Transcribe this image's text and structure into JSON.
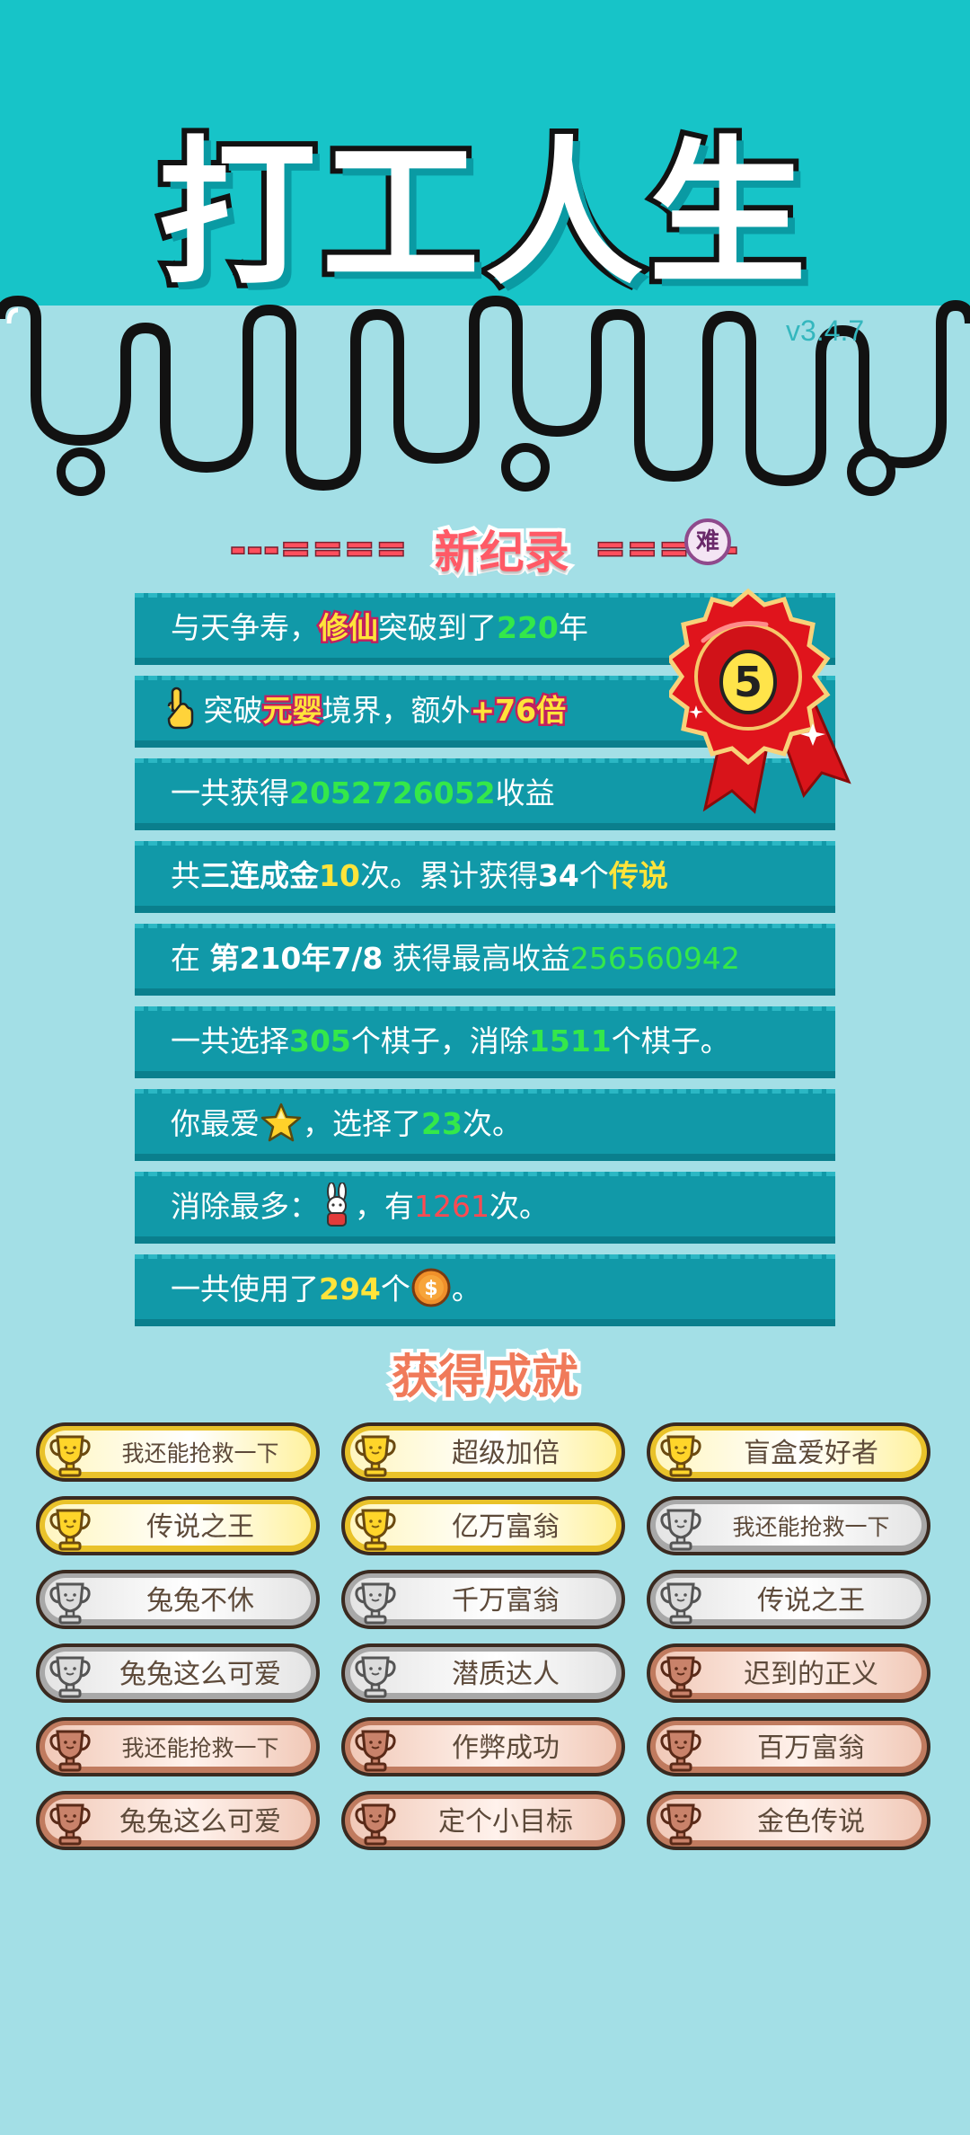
{
  "game": {
    "title": "打工人生",
    "version": "v3.4.7"
  },
  "record_banner": {
    "left_dashes": "---====",
    "title": "新纪录",
    "right_dashes": "====-",
    "difficulty_badge": "难"
  },
  "medal": {
    "rank": "5"
  },
  "stats": [
    {
      "parts": [
        "与天争寿，",
        "修仙",
        "突破到了",
        "220",
        "年"
      ]
    },
    {
      "parts": [
        "突破",
        "元婴",
        "境界，额外",
        "+76倍"
      ]
    },
    {
      "parts": [
        "一共获得",
        "2052726052",
        "收益"
      ]
    },
    {
      "parts": [
        "共",
        "三连成金",
        "10",
        "次。累计获得",
        "34",
        "个",
        "传说"
      ]
    },
    {
      "parts": [
        "在 ",
        "第210年7/8",
        " 获得最高收益",
        "256560942"
      ]
    },
    {
      "parts": [
        "一共选择",
        "305",
        "个棋子，消除",
        "1511",
        "个棋子。"
      ]
    },
    {
      "parts": [
        "你最爱",
        "，选择了",
        "23",
        "次。"
      ]
    },
    {
      "parts": [
        "消除最多：",
        "，有",
        "1261",
        "次。"
      ]
    },
    {
      "parts": [
        "一共使用了",
        "294",
        "个",
        "。"
      ]
    }
  ],
  "icons": {
    "row2": "pointing-hand-icon",
    "row7": "star-icon",
    "row8": "rabbit-icon",
    "row9": "coin-icon"
  },
  "achievements_title": "获得成就",
  "achievements": [
    {
      "label": "我还能抢救一下",
      "tier": "gold"
    },
    {
      "label": "超级加倍",
      "tier": "gold"
    },
    {
      "label": "盲盒爱好者",
      "tier": "gold"
    },
    {
      "label": "传说之王",
      "tier": "gold"
    },
    {
      "label": "亿万富翁",
      "tier": "gold"
    },
    {
      "label": "我还能抢救一下",
      "tier": "silver"
    },
    {
      "label": "兔兔不休",
      "tier": "silver"
    },
    {
      "label": "千万富翁",
      "tier": "silver"
    },
    {
      "label": "传说之王",
      "tier": "silver"
    },
    {
      "label": "兔兔这么可爱",
      "tier": "silver"
    },
    {
      "label": "潜质达人",
      "tier": "silver"
    },
    {
      "label": "迟到的正义",
      "tier": "bronze"
    },
    {
      "label": "我还能抢救一下",
      "tier": "bronze"
    },
    {
      "label": "作弊成功",
      "tier": "bronze"
    },
    {
      "label": "百万富翁",
      "tier": "bronze"
    },
    {
      "label": "兔兔这么可爱",
      "tier": "bronze"
    },
    {
      "label": "定个小目标",
      "tier": "bronze"
    },
    {
      "label": "金色传说",
      "tier": "bronze"
    }
  ],
  "colors": {
    "top_background": "#17c4c8",
    "page_background": "#a3dfe6",
    "row_background": "#1199a8",
    "highlight_green": "#34e84a",
    "highlight_yellow": "#ffe43a",
    "highlight_red": "#ff4a52",
    "gold": "#e9c22a",
    "silver": "#a8a8a8",
    "bronze": "#c07b5f"
  }
}
